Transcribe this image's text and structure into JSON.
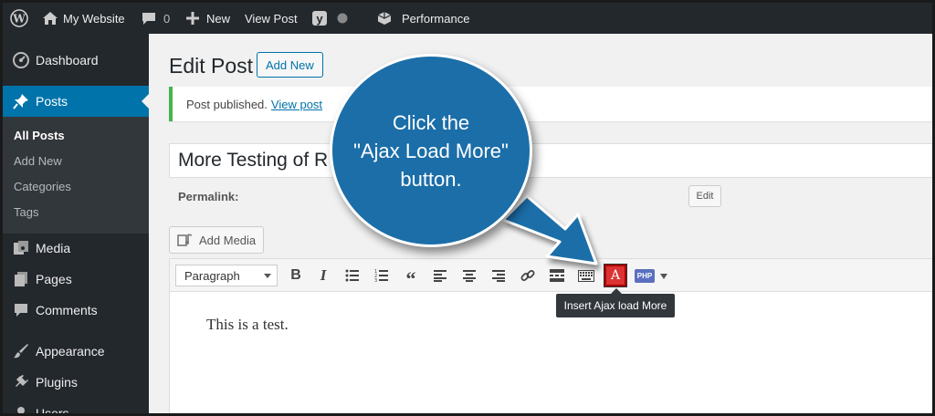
{
  "admin_bar": {
    "site_name": "My Website",
    "comments_count": "0",
    "new_label": "New",
    "view_post_label": "View Post",
    "performance_label": "Performance"
  },
  "sidebar": {
    "items": [
      {
        "label": "Dashboard",
        "icon": "dashboard-icon"
      },
      {
        "label": "Posts",
        "icon": "pin-icon",
        "active": true
      },
      {
        "label": "Media",
        "icon": "media-icon"
      },
      {
        "label": "Pages",
        "icon": "pages-icon"
      },
      {
        "label": "Comments",
        "icon": "comment-icon"
      },
      {
        "label": "Appearance",
        "icon": "brush-icon"
      },
      {
        "label": "Plugins",
        "icon": "plug-icon"
      },
      {
        "label": "Users",
        "icon": "users-icon"
      }
    ],
    "submenu": [
      "All Posts",
      "Add New",
      "Categories",
      "Tags"
    ]
  },
  "main": {
    "page_title": "Edit Post",
    "add_new_label": "Add New",
    "notice_text": "Post published.",
    "notice_link": "View post",
    "post_title": "More Testing of R",
    "permalink_label": "Permalink:",
    "edit_label": "Edit",
    "add_media_label": "Add Media"
  },
  "editor": {
    "format_value": "Paragraph",
    "tooltip": "Insert Ajax load More",
    "body_text": "This is a test.",
    "ajax_button_glyph": "A",
    "php_button_label": "PHP"
  },
  "callout": {
    "line1": "Click the",
    "line2": "\"Ajax Load More\"",
    "line3": "button."
  },
  "colors": {
    "admin_bg": "#23282d",
    "accent": "#0073aa",
    "success": "#46b450",
    "callout": "#1b6ea8",
    "ajax_button": "#dc3232"
  }
}
